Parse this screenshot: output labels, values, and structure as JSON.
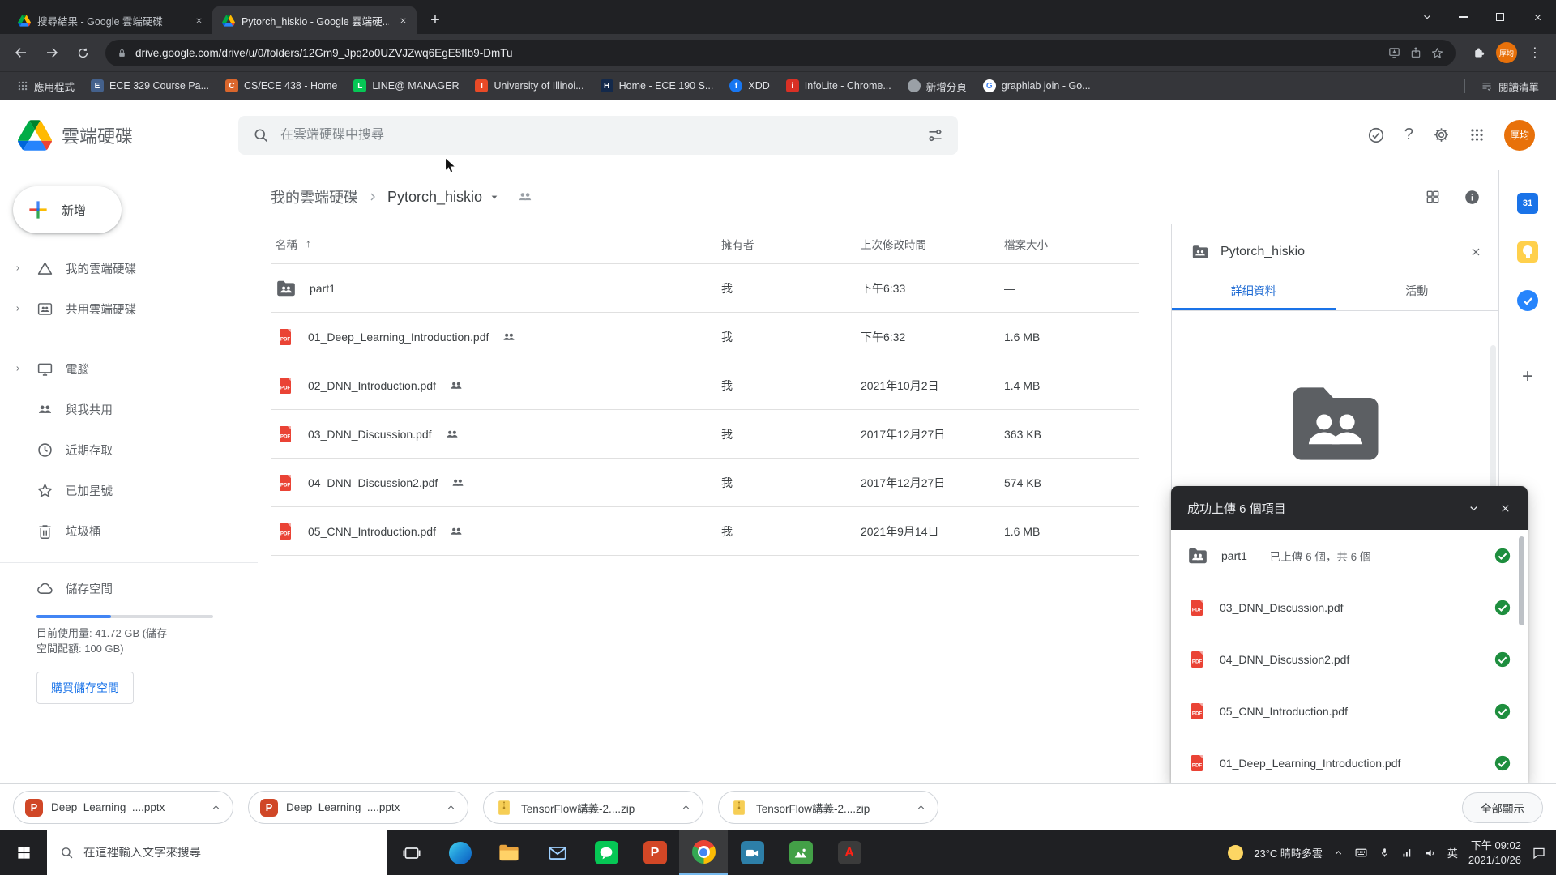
{
  "colors": {
    "accent_blue": "#1a73e8",
    "pdf_red": "#ea4335",
    "success_green": "#1e8e3e",
    "folder_gray": "#5f6368",
    "toast_header": "#27282b",
    "chrome_dark": "#202124",
    "chrome_toolbar": "#35363a",
    "search_field": "#f1f3f4",
    "avatar_orange": "#e8710a"
  },
  "icons": {
    "drive-logo": "colored triangle",
    "search-icon": "magnifier",
    "search-options-icon": "tune sliders",
    "offline-ready-icon": "check in circle",
    "help-icon": "question mark",
    "settings-icon": "gear",
    "apps-grid-icon": "3x3 dots",
    "folder-shared-icon": "gray folder with two people",
    "pdf-icon": "red PDF page",
    "shared-people-icon": "two person silhouettes",
    "success-check-icon": "green circle with white check",
    "info-icon": "filled i circle",
    "grid-view-icon": "2x2 squares",
    "sort-ascending-icon": "up arrow",
    "windows-start-icon": "four panes",
    "chrome-icon": "colored ball",
    "close-icon": "x",
    "chevron-up-icon": "caret up",
    "chevron-down-icon": "caret down"
  },
  "browser": {
    "tabs": [
      {
        "title": "搜尋結果 - Google 雲端硬碟"
      },
      {
        "title": "Pytorch_hiskio - Google 雲端硬..."
      }
    ],
    "url": "drive.google.com/drive/u/0/folders/12Gm9_Jpq2o0UZVJZwq6EgE5fIb9-DmTu",
    "avatar": "厚均",
    "bookmarks": [
      "應用程式",
      "ECE 329 Course Pa...",
      "CS/ECE 438 - Home",
      "LINE@ MANAGER",
      "University of Illinoi...",
      "Home - ECE 190 S...",
      "XDD",
      "InfoLite - Chrome...",
      "新增分頁",
      "graphlab join - Go..."
    ],
    "reading_list": "閱讀清單"
  },
  "drive": {
    "logo_text": "雲端硬碟",
    "search_placeholder": "在雲端硬碟中搜尋",
    "avatar": "厚均",
    "sidebar": {
      "new_label": "新增",
      "items": [
        "我的雲端硬碟",
        "共用雲端硬碟",
        "電腦",
        "與我共用",
        "近期存取",
        "已加星號",
        "垃圾桶"
      ],
      "storage_title": "儲存空間",
      "storage_line1": "目前使用量:  41.72 GB (儲存",
      "storage_line2": "空間配額: 100 GB)",
      "storage_used_percent": 42,
      "buy_label": "購買儲存空間"
    },
    "breadcrumb": {
      "root": "我的雲端硬碟",
      "current": "Pytorch_hiskio"
    },
    "table": {
      "headers": {
        "name": "名稱",
        "owner": "擁有者",
        "modified": "上次修改時間",
        "size": "檔案大小"
      },
      "rows": [
        {
          "name": "part1",
          "owner": "我",
          "modified": "下午6:33",
          "size": "—"
        },
        {
          "name": "01_Deep_Learning_Introduction.pdf",
          "owner": "我",
          "modified": "下午6:32",
          "size": "1.6 MB"
        },
        {
          "name": "02_DNN_Introduction.pdf",
          "owner": "我",
          "modified": "2021年10月2日",
          "size": "1.4 MB"
        },
        {
          "name": "03_DNN_Discussion.pdf",
          "owner": "我",
          "modified": "2017年12月27日",
          "size": "363 KB"
        },
        {
          "name": "04_DNN_Discussion2.pdf",
          "owner": "我",
          "modified": "2017年12月27日",
          "size": "574 KB"
        },
        {
          "name": "05_CNN_Introduction.pdf",
          "owner": "我",
          "modified": "2021年9月14日",
          "size": "1.6 MB"
        }
      ]
    },
    "details": {
      "title": "Pytorch_hiskio",
      "tab_details": "詳細資料",
      "tab_activity": "活動"
    },
    "toast": {
      "title": "成功上傳 6 個項目",
      "items": [
        {
          "name": "part1",
          "status": "已上傳 6 個，共 6 個"
        },
        {
          "name": "03_DNN_Discussion.pdf"
        },
        {
          "name": "04_DNN_Discussion2.pdf"
        },
        {
          "name": "05_CNN_Introduction.pdf"
        },
        {
          "name": "01_Deep_Learning_Introduction.pdf"
        }
      ]
    }
  },
  "downloads": {
    "items": [
      {
        "name": "Deep_Learning_....pptx"
      },
      {
        "name": "Deep_Learning_....pptx"
      },
      {
        "name": "TensorFlow講義-2....zip"
      },
      {
        "name": "TensorFlow講義-2....zip"
      }
    ],
    "show_all": "全部顯示"
  },
  "taskbar": {
    "search_placeholder": "在這裡輸入文字來搜尋",
    "weather": "23°C 晴時多雲",
    "language": "英",
    "time": "下午 09:02",
    "date": "2021/10/26"
  }
}
